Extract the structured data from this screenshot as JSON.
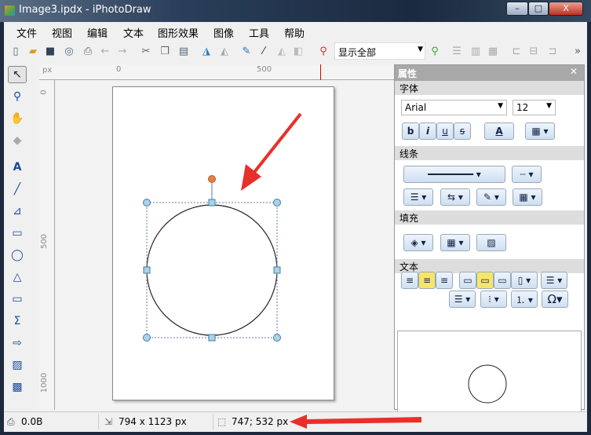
{
  "window": {
    "title": "Image3.ipdx - iPhotoDraw",
    "minimize": "–",
    "maximize": "□",
    "close": "X"
  },
  "menu": [
    "文件",
    "视图",
    "编辑",
    "文本",
    "图形效果",
    "图像",
    "工具",
    "帮助"
  ],
  "toolbar": {
    "zoom_value": "显示全部",
    "overflow": "»"
  },
  "ruler": {
    "unit": "px",
    "top_ticks": [
      "0",
      "500"
    ],
    "left_ticks": [
      "0",
      "500",
      "1000"
    ]
  },
  "panel": {
    "title": "属性",
    "close": "✕",
    "font_section": "字体",
    "font_name": "Arial",
    "font_size": "12",
    "bold": "b",
    "italic": "i",
    "underline": "u",
    "strike": "s",
    "font_color": "A",
    "line_section": "线条",
    "fill_section": "填充",
    "text_section": "文本",
    "omega": "Ω"
  },
  "status": {
    "size": "0.0B",
    "dimensions": "794 x 1123 px",
    "cursor": "747; 532 px"
  },
  "colors": {
    "arrow": "#e8302a",
    "handle": "#a8d4ea",
    "rotate_handle": "#e8823a"
  }
}
